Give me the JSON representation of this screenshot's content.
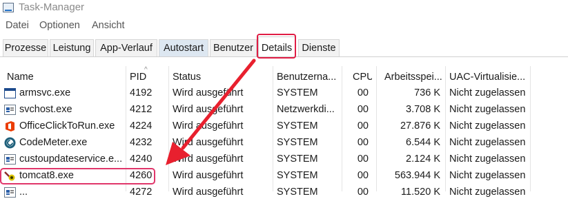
{
  "window": {
    "title": "Task-Manager"
  },
  "menu": {
    "items": [
      "Datei",
      "Optionen",
      "Ansicht"
    ]
  },
  "tabs": [
    {
      "label": "Prozesse"
    },
    {
      "label": "Leistung"
    },
    {
      "label": "App-Verlauf"
    },
    {
      "label": "Autostart"
    },
    {
      "label": "Benutzer"
    },
    {
      "label": "Details"
    },
    {
      "label": "Dienste"
    }
  ],
  "columns": [
    "Name",
    "PID",
    "Status",
    "Benutzerna...",
    "CPU",
    "Arbeitsspei...",
    "UAC-Virtualisie..."
  ],
  "rows": [
    {
      "name": "armsvc.exe",
      "pid": "4192",
      "status": "Wird ausgeführt",
      "user": "SYSTEM",
      "cpu": "00",
      "mem": "736 K",
      "uac": "Nicht zugelassen",
      "icon": "window-app-icon"
    },
    {
      "name": "svchost.exe",
      "pid": "4212",
      "status": "Wird ausgeführt",
      "user": "Netzwerkdi...",
      "cpu": "00",
      "mem": "3.708 K",
      "uac": "Nicht zugelassen",
      "icon": "service-host-icon"
    },
    {
      "name": "OfficeClickToRun.exe",
      "pid": "4224",
      "status": "Wird ausgeführt",
      "user": "SYSTEM",
      "cpu": "00",
      "mem": "27.876 K",
      "uac": "Nicht zugelassen",
      "icon": "office-icon"
    },
    {
      "name": "CodeMeter.exe",
      "pid": "4232",
      "status": "Wird ausgeführt",
      "user": "SYSTEM",
      "cpu": "00",
      "mem": "6.544 K",
      "uac": "Nicht zugelassen",
      "icon": "codemeter-icon"
    },
    {
      "name": "custoupdateservice.e...",
      "pid": "4240",
      "status": "Wird ausgeführt",
      "user": "SYSTEM",
      "cpu": "00",
      "mem": "2.124 K",
      "uac": "Nicht zugelassen",
      "icon": "service-host-icon"
    },
    {
      "name": "tomcat8.exe",
      "pid": "4260",
      "status": "Wird ausgeführt",
      "user": "SYSTEM",
      "cpu": "00",
      "mem": "563.944 K",
      "uac": "Nicht zugelassen",
      "icon": "tomcat-icon"
    },
    {
      "name": "...",
      "pid": "4272",
      "status": "Wird ausgeführt",
      "user": "SYSTEM",
      "cpu": "00",
      "mem": "11.520 K",
      "uac": "Nicht zugelassen",
      "icon": "service-host-icon"
    }
  ],
  "colors": {
    "annotation": "#e01c44",
    "tab_alt": "#dde7f1",
    "arrow": "#e8202e"
  }
}
